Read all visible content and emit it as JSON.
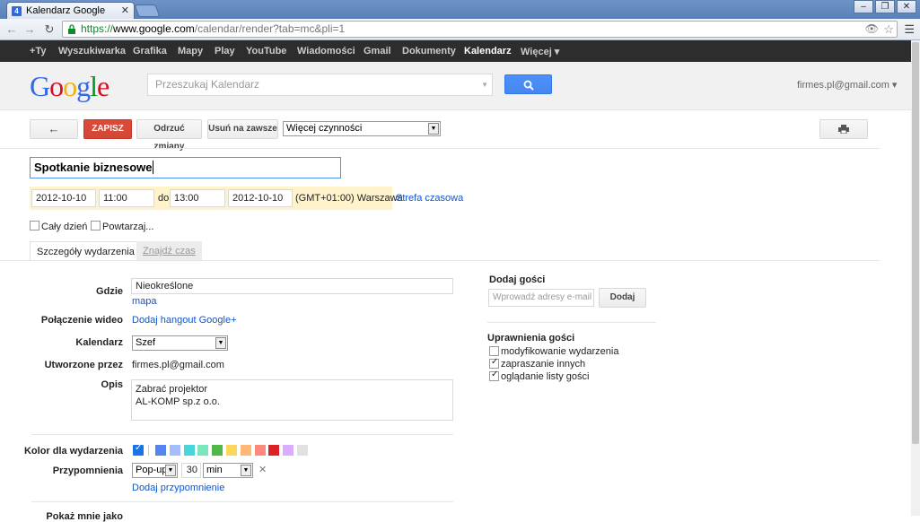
{
  "browser": {
    "tab_title": "Kalendarz Google",
    "tab_favicon": "4",
    "url_scheme": "https://",
    "url_host": "www.google.com",
    "url_path": "/calendar/render?tab=mc&pli=1"
  },
  "gbar": [
    "+Ty",
    "Wyszukiwarka",
    "Grafika",
    "Mapy",
    "Play",
    "YouTube",
    "Wiadomości",
    "Gmail",
    "Dokumenty",
    "Kalendarz",
    "Więcej ▾"
  ],
  "header": {
    "logo": [
      "G",
      "o",
      "o",
      "g",
      "l",
      "e"
    ],
    "search_placeholder": "Przeszukaj Kalendarz",
    "account": "firmes.pl@gmail.com ▾"
  },
  "actions": {
    "back": "←",
    "save": "ZAPISZ",
    "discard": "Odrzuć zmiany",
    "delete": "Usuń na zawsze",
    "more": "Więcej czynności"
  },
  "event": {
    "title": "Spotkanie biznesowe",
    "start_date": "2012-10-10",
    "start_time": "11:00",
    "to": "do",
    "end_time": "13:00",
    "end_date": "2012-10-10",
    "timezone": "(GMT+01:00) Warszawa",
    "timezone_link": "Strefa czasowa",
    "all_day": "Cały dzień",
    "repeat": "Powtarzaj..."
  },
  "tabs": {
    "details": "Szczegóły wydarzenia",
    "find_time": "Znajdź czas"
  },
  "details": {
    "where_label": "Gdzie",
    "where_value": "Nieokreślone",
    "map_link": "mapa",
    "video_label": "Połączenie wideo",
    "video_link": "Dodaj hangout Google+",
    "calendar_label": "Kalendarz",
    "calendar_value": "Szef",
    "created_label": "Utworzone przez",
    "created_value": "firmes.pl@gmail.com",
    "desc_label": "Opis",
    "desc_line1": "Zabrać projektor",
    "desc_line2": "AL-KOMP sp.z o.o.",
    "color_label": "Kolor dla wydarzenia",
    "colors": [
      "#5484ed",
      "#a4bdfc",
      "#46d6db",
      "#7ae7bf",
      "#51b749",
      "#fbd75b",
      "#ffb878",
      "#ff887c",
      "#dc2127",
      "#dbadff",
      "#e1e1e1"
    ],
    "reminder_label": "Przypomnienia",
    "reminder_type": "Pop-up",
    "reminder_value": "30",
    "reminder_unit": "min",
    "add_reminder": "Dodaj przypomnienie",
    "bottom_label": "Pokaż mnie jako"
  },
  "guests": {
    "title": "Dodaj gości",
    "placeholder": "Wprowadź adresy e-mail",
    "add": "Dodaj",
    "perm_title": "Uprawnienia gości",
    "perm1": "modyfikowanie wydarzenia",
    "perm2": "zapraszanie innych",
    "perm3": "oglądanie listy gości",
    "perm1_checked": false,
    "perm2_checked": true,
    "perm3_checked": true
  }
}
